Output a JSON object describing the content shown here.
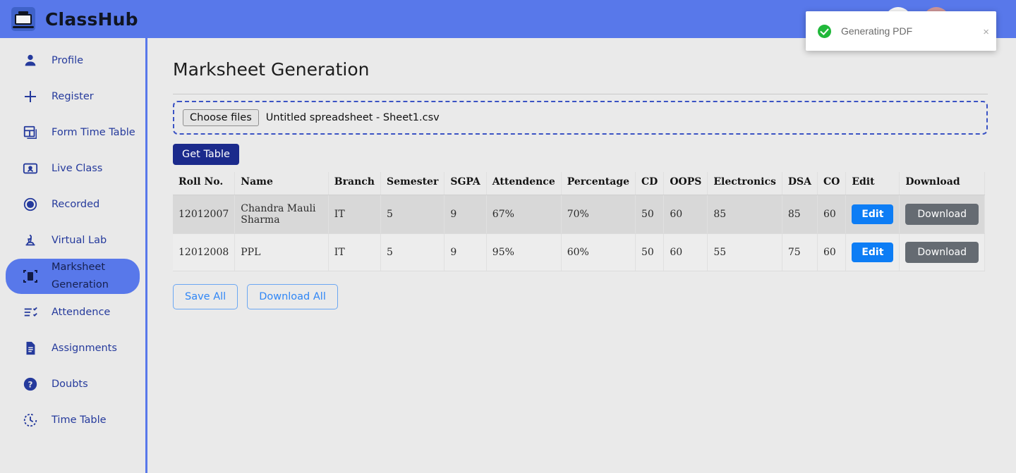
{
  "header": {
    "brand": "ClassHub",
    "logo_icon": "graduation-laptop-icon",
    "avatar1_icon": "user-avatar",
    "avatar2_icon": "user-avatar",
    "next_arrow_icon": "arrow-right-icon",
    "bg_color": "#5878ea"
  },
  "sidebar": {
    "items": [
      {
        "label": "Profile",
        "icon": "person-icon",
        "active": false
      },
      {
        "label": "Register",
        "icon": "plus-icon",
        "active": false
      },
      {
        "label": "Form Time Table",
        "icon": "table-grid-icon",
        "active": false
      },
      {
        "label": "Live Class",
        "icon": "video-card-icon",
        "active": false
      },
      {
        "label": "Recorded",
        "icon": "record-circle-icon",
        "active": false
      },
      {
        "label": "Virtual Lab",
        "icon": "microscope-icon",
        "active": false
      },
      {
        "label": "Marksheet Generation",
        "icon": "scan-document-icon",
        "active": true
      },
      {
        "label": "Attendence",
        "icon": "checklist-icon",
        "active": false
      },
      {
        "label": "Assignments",
        "icon": "document-icon",
        "active": false
      },
      {
        "label": "Doubts",
        "icon": "question-circle-icon",
        "active": false
      },
      {
        "label": "Time Table",
        "icon": "clock-icon",
        "active": false
      }
    ],
    "active_color": "#5878ea"
  },
  "main": {
    "page_title": "Marksheet Generation",
    "upload": {
      "choose_files_label": "Choose files",
      "file_name": "Untitled spreadsheet - Sheet1.csv",
      "border_color": "#3b53c4"
    },
    "get_table_label": "Get Table",
    "table": {
      "columns": [
        "Roll No.",
        "Name",
        "Branch",
        "Semester",
        "SGPA",
        "Attendence",
        "Percentage",
        "CD",
        "OOPS",
        "Electronics",
        "DSA",
        "CO",
        "Edit",
        "Download"
      ],
      "rows": [
        {
          "roll_no": "12012007",
          "name": "Chandra Mauli Sharma",
          "branch": "IT",
          "semester": "5",
          "sgpa": "9",
          "attendence": "67%",
          "percentage": "70%",
          "cd": "50",
          "oops": "60",
          "electronics": "85",
          "dsa": "85",
          "co": "60",
          "edit_label": "Edit",
          "download_label": "Download"
        },
        {
          "roll_no": "12012008",
          "name": "PPL",
          "branch": "IT",
          "semester": "5",
          "sgpa": "9",
          "attendence": "95%",
          "percentage": "60%",
          "cd": "50",
          "oops": "60",
          "electronics": "55",
          "dsa": "75",
          "co": "60",
          "edit_label": "Edit",
          "download_label": "Download"
        }
      ],
      "edit_button_color": "#0d7df5",
      "download_button_color": "#656b72"
    },
    "footer": {
      "save_all_label": "Save All",
      "download_all_label": "Download All"
    }
  },
  "toast": {
    "message": "Generating PDF",
    "status_icon": "success-check-icon",
    "close_icon": "close-icon",
    "close_label": "×",
    "accent_color": "#20b83a"
  }
}
